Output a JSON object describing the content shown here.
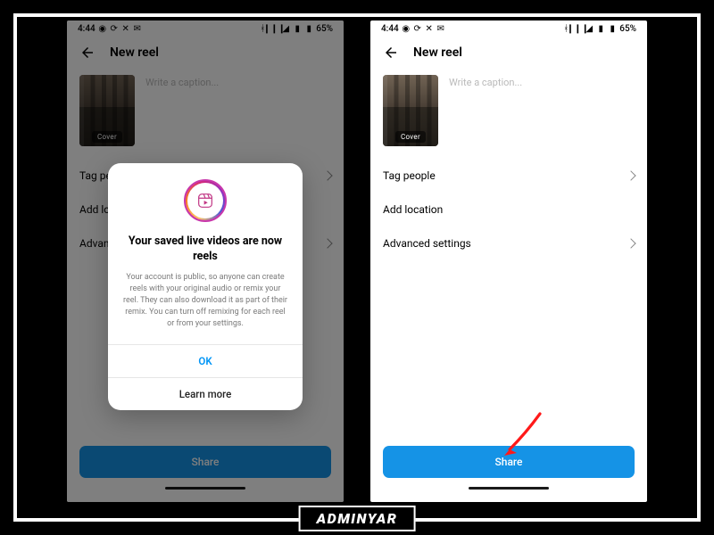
{
  "status": {
    "time": "4:44",
    "battery": "65%"
  },
  "screen": {
    "title": "New reel",
    "thumb_label": "Cover",
    "caption_placeholder": "Write a caption...",
    "menu": {
      "tag_people": "Tag people",
      "add_location": "Add location",
      "advanced": "Advanced settings"
    },
    "share": "Share"
  },
  "modal": {
    "title": "Your saved live videos are now reels",
    "body": "Your account is public, so anyone can create reels with your original audio or remix your reel. They can also download it as part of their remix. You can turn off remixing for each reel or from your settings.",
    "ok": "OK",
    "learn_more": "Learn more"
  },
  "watermark": "ADMINYAR"
}
